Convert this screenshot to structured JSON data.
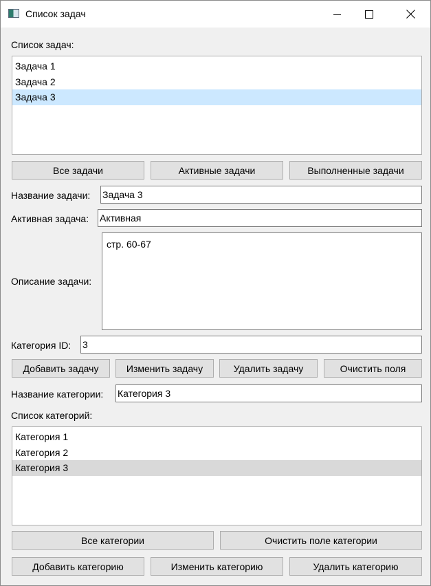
{
  "window": {
    "title": "Список задач"
  },
  "tasks": {
    "list_label": "Список задач:",
    "items": [
      "Задача 1",
      "Задача 2",
      "Задача 3"
    ],
    "selected_index": 2
  },
  "filters": {
    "all": "Все задачи",
    "active": "Активные задачи",
    "done": "Выполненные задачи"
  },
  "form": {
    "name_label": "Название задачи:",
    "name_value": "Задача 3",
    "active_label": "Активная задача:",
    "active_value": "Активная",
    "desc_label": "Описание задачи:",
    "desc_value": "стр. 60-67",
    "category_id_label": "Категория ID:",
    "category_id_value": "3"
  },
  "task_actions": {
    "add": "Добавить задачу",
    "edit": "Изменить задачу",
    "delete": "Удалить задачу",
    "clear": "Очистить поля"
  },
  "category_form": {
    "name_label": "Название категории:",
    "name_value": "Категория 3",
    "list_label": "Список категорий:",
    "items": [
      "Категория 1",
      "Категория 2",
      "Категория 3"
    ],
    "selected_index": 2
  },
  "category_actions": {
    "all": "Все категории",
    "clear": "Очистить поле категории",
    "add": "Добавить категорию",
    "edit": "Изменить категорию",
    "delete": "Удалить категорию"
  },
  "icons": {
    "app": "app-window-icon",
    "minimize": "minimize-icon",
    "maximize": "maximize-icon",
    "close": "close-icon"
  },
  "colors": {
    "selection_focused": "#cce8ff",
    "selection_unfocused": "#d9d9d9",
    "button_face": "#e1e1e1",
    "window_bg": "#f0f0f0"
  }
}
